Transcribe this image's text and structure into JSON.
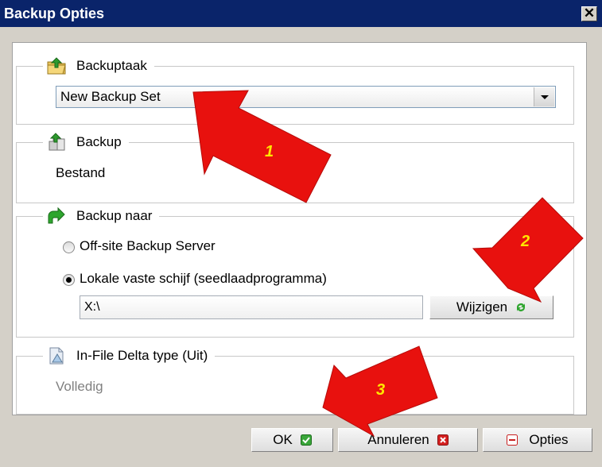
{
  "window": {
    "title": "Backup Opties",
    "close_glyph": "✕"
  },
  "backup_task": {
    "legend": "Backuptaak",
    "icon": "upload-folder-icon",
    "selected": "New Backup Set"
  },
  "backup_source": {
    "legend": "Backup",
    "icon": "upload-files-icon",
    "value": "Bestand"
  },
  "backup_destination": {
    "legend": "Backup naar",
    "icon": "green-arrow-icon",
    "options": [
      {
        "label": "Off-site Backup Server",
        "selected": false
      },
      {
        "label": "Lokale vaste schijf (seedlaadprogramma)",
        "selected": true
      }
    ],
    "path": "X:\\",
    "change_label": "Wijzigen"
  },
  "delta": {
    "legend": "In-File Delta type (Uit)",
    "icon": "delta-file-icon",
    "value": "Volledig"
  },
  "footer": {
    "ok_label": "OK",
    "cancel_label": "Annuleren",
    "options_label": "Opties"
  },
  "annotations": {
    "arrow_1": "1",
    "arrow_2": "2",
    "arrow_3": "3"
  },
  "colors": {
    "title_bar": "#0a246a",
    "annotation_arrow": "#e8110e",
    "annotation_number": "#ffe600"
  }
}
